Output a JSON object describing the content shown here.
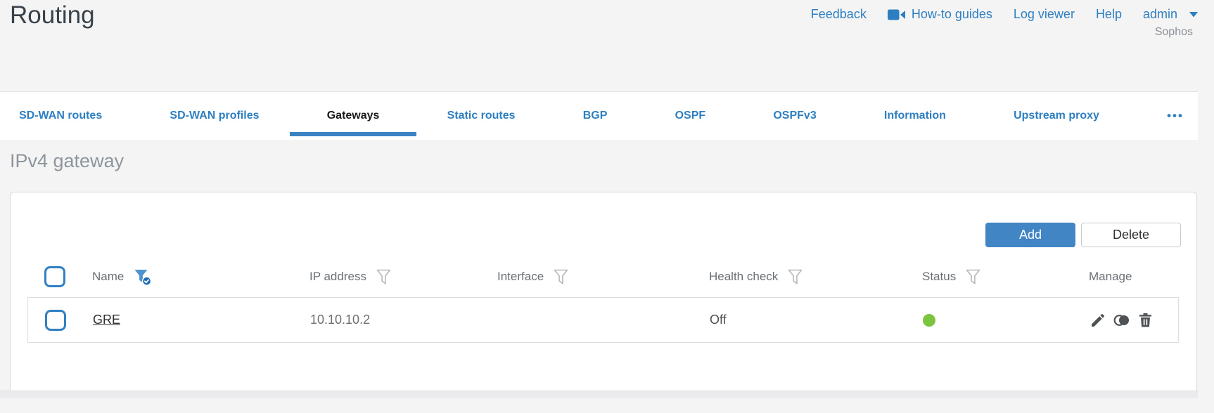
{
  "header": {
    "title": "Routing",
    "nav": {
      "feedback": "Feedback",
      "howto": "How-to guides",
      "logviewer": "Log viewer",
      "help": "Help",
      "user": "admin"
    },
    "account": "Sophos"
  },
  "tabs": [
    {
      "label": "SD-WAN routes",
      "active": false
    },
    {
      "label": "SD-WAN profiles",
      "active": false
    },
    {
      "label": "Gateways",
      "active": true
    },
    {
      "label": "Static routes",
      "active": false
    },
    {
      "label": "BGP",
      "active": false
    },
    {
      "label": "OSPF",
      "active": false
    },
    {
      "label": "OSPFv3",
      "active": false
    },
    {
      "label": "Information",
      "active": false
    },
    {
      "label": "Upstream proxy",
      "active": false
    }
  ],
  "tabs_more": "•••",
  "section": {
    "heading": "IPv4 gateway"
  },
  "toolbar": {
    "add": "Add",
    "delete": "Delete"
  },
  "table": {
    "columns": [
      {
        "label": "Name",
        "filter": "active"
      },
      {
        "label": "IP address",
        "filter": "default"
      },
      {
        "label": "Interface",
        "filter": "default"
      },
      {
        "label": "Health check",
        "filter": "default"
      },
      {
        "label": "Status",
        "filter": "default"
      },
      {
        "label": "Manage",
        "filter": "none"
      }
    ],
    "rows": [
      {
        "name": "GRE",
        "ip_address": "10.10.10.2",
        "interface": "",
        "health_check": "Off",
        "status": "up",
        "manage": [
          "edit",
          "clone",
          "delete"
        ]
      }
    ]
  },
  "colors": {
    "link_blue": "#2e7fc2",
    "button_blue": "#4285c4",
    "active_underline": "#3b82c4",
    "status_green": "#7cc33f",
    "icon_gray": "#4f5254",
    "funnel_gray": "#b5b9bc",
    "funnel_active_blue": "#4e93ce",
    "funnel_badge_blue": "#1c6cb4"
  }
}
